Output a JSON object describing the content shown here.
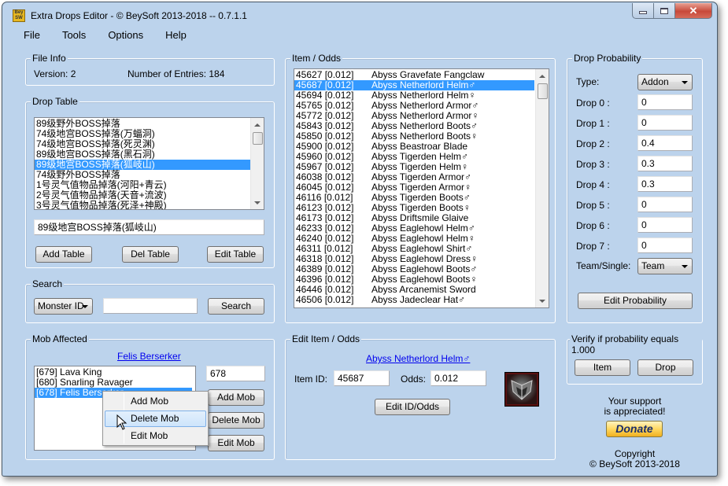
{
  "window": {
    "title": "Extra Drops Editor - © BeySoft  2013-2018  --  0.7.1.1",
    "icon_text": "Bey SW",
    "caption_buttons": [
      "minimize-icon",
      "maximize-icon",
      "close-icon"
    ]
  },
  "menu": [
    "File",
    "Tools",
    "Options",
    "Help"
  ],
  "file_info": {
    "title": "File Info",
    "version_label": "Version: 2",
    "entries_label": "Number of Entries: 184"
  },
  "drop_table": {
    "title": "Drop Table",
    "items": [
      "89级野外BOSS掉落",
      "74级地宫BOSS掉落(万蝠洞)",
      "74级地宫BOSS掉落(死灵渊)",
      "89级地宫BOSS掉落(黑石洞)",
      "89级地宫BOSS掉落(狐岐山)",
      "74级野外BOSS掉落",
      "1号灵气值物品掉落(河阳+青云)",
      "2号灵气值物品掉落(天音+流波)",
      "3号灵气值物品掉落(死泽+神殿)"
    ],
    "selected_index": 4,
    "name_value": "89级地宫BOSS掉落(狐岐山)",
    "buttons": {
      "add": "Add Table",
      "del": "Del Table",
      "edit": "Edit Table"
    }
  },
  "search": {
    "title": "Search",
    "mode": "Monster ID",
    "query": "",
    "button": "Search"
  },
  "mob_affected": {
    "title": "Mob Affected",
    "link": "Felis Berserker",
    "items": [
      "[679] Lava King",
      "[680] Snarling Ravager",
      "[678] Felis Berserker"
    ],
    "selected_index": 2,
    "id_value": "678",
    "buttons": {
      "add": "Add Mob",
      "delete": "Delete Mob",
      "edit": "Edit Mob"
    }
  },
  "context_menu": {
    "items": [
      "Add Mob",
      "Delete Mob",
      "Edit Mob"
    ],
    "hover_index": 1
  },
  "item_odds": {
    "title": "Item / Odds",
    "selected_index": 1,
    "items": [
      {
        "id": "45627 [0.012]",
        "name": "Abyss Gravefate Fangclaw"
      },
      {
        "id": "45687 [0.012]",
        "name": "Abyss Netherlord Helm♂"
      },
      {
        "id": "45694 [0.012]",
        "name": "Abyss Netherlord Helm♀"
      },
      {
        "id": "45765 [0.012]",
        "name": "Abyss Netherlord Armor♂"
      },
      {
        "id": "45772 [0.012]",
        "name": "Abyss Netherlord Armor♀"
      },
      {
        "id": "45843 [0.012]",
        "name": "Abyss Netherlord Boots♂"
      },
      {
        "id": "45850 [0.012]",
        "name": "Abyss Netherlord Boots♀"
      },
      {
        "id": "45900 [0.012]",
        "name": "Abyss Beastroar Blade"
      },
      {
        "id": "45960 [0.012]",
        "name": "Abyss Tigerden Helm♂"
      },
      {
        "id": "45967 [0.012]",
        "name": "Abyss Tigerden Helm♀"
      },
      {
        "id": "46038 [0.012]",
        "name": "Abyss Tigerden Armor♂"
      },
      {
        "id": "46045 [0.012]",
        "name": "Abyss Tigerden Armor♀"
      },
      {
        "id": "46116 [0.012]",
        "name": "Abyss Tigerden Boots♂"
      },
      {
        "id": "46123 [0.012]",
        "name": "Abyss Tigerden Boots♀"
      },
      {
        "id": "46173 [0.012]",
        "name": "Abyss Driftsmile Glaive"
      },
      {
        "id": "46233 [0.012]",
        "name": "Abyss Eaglehowl Helm♂"
      },
      {
        "id": "46240 [0.012]",
        "name": "Abyss Eaglehowl Helm♀"
      },
      {
        "id": "46311 [0.012]",
        "name": "Abyss Eaglehowl Shirt♂"
      },
      {
        "id": "46318 [0.012]",
        "name": "Abyss Eaglehowl Dress♀"
      },
      {
        "id": "46389 [0.012]",
        "name": "Abyss Eaglehowl Boots♂"
      },
      {
        "id": "46396 [0.012]",
        "name": "Abyss Eaglehowl Boots♀"
      },
      {
        "id": "46446 [0.012]",
        "name": "Abyss Arcanemist Sword"
      },
      {
        "id": "46506 [0.012]",
        "name": "Abyss Jadeclear Hat♂"
      }
    ]
  },
  "edit_item": {
    "title": "Edit Item / Odds",
    "link": "Abyss Netherlord Helm♂",
    "item_id_label": "Item ID:",
    "item_id_value": "45687",
    "odds_label": "Odds:",
    "odds_value": "0.012",
    "button": "Edit ID/Odds",
    "icon": "helm-item-icon"
  },
  "drop_probability": {
    "title": "Drop Probability",
    "type_label": "Type:",
    "type_value": "Addon",
    "drops": [
      {
        "label": "Drop 0 :",
        "value": "0"
      },
      {
        "label": "Drop 1 :",
        "value": "0"
      },
      {
        "label": "Drop 2 :",
        "value": "0.4"
      },
      {
        "label": "Drop 3 :",
        "value": "0.3"
      },
      {
        "label": "Drop 4 :",
        "value": "0.3"
      },
      {
        "label": "Drop 5 :",
        "value": "0"
      },
      {
        "label": "Drop 6 :",
        "value": "0"
      },
      {
        "label": "Drop 7 :",
        "value": "0"
      }
    ],
    "team_label": "Team/Single:",
    "team_value": "Team",
    "button": "Edit Probability"
  },
  "verify": {
    "title": "Verify if probability equals 1.000",
    "item_button": "Item",
    "drop_button": "Drop"
  },
  "support": {
    "line1": "Your support",
    "line2": "is appreciated!",
    "donate": "Donate",
    "copyright1": "Copyright",
    "copyright2": "© BeySoft  2013-2018"
  }
}
